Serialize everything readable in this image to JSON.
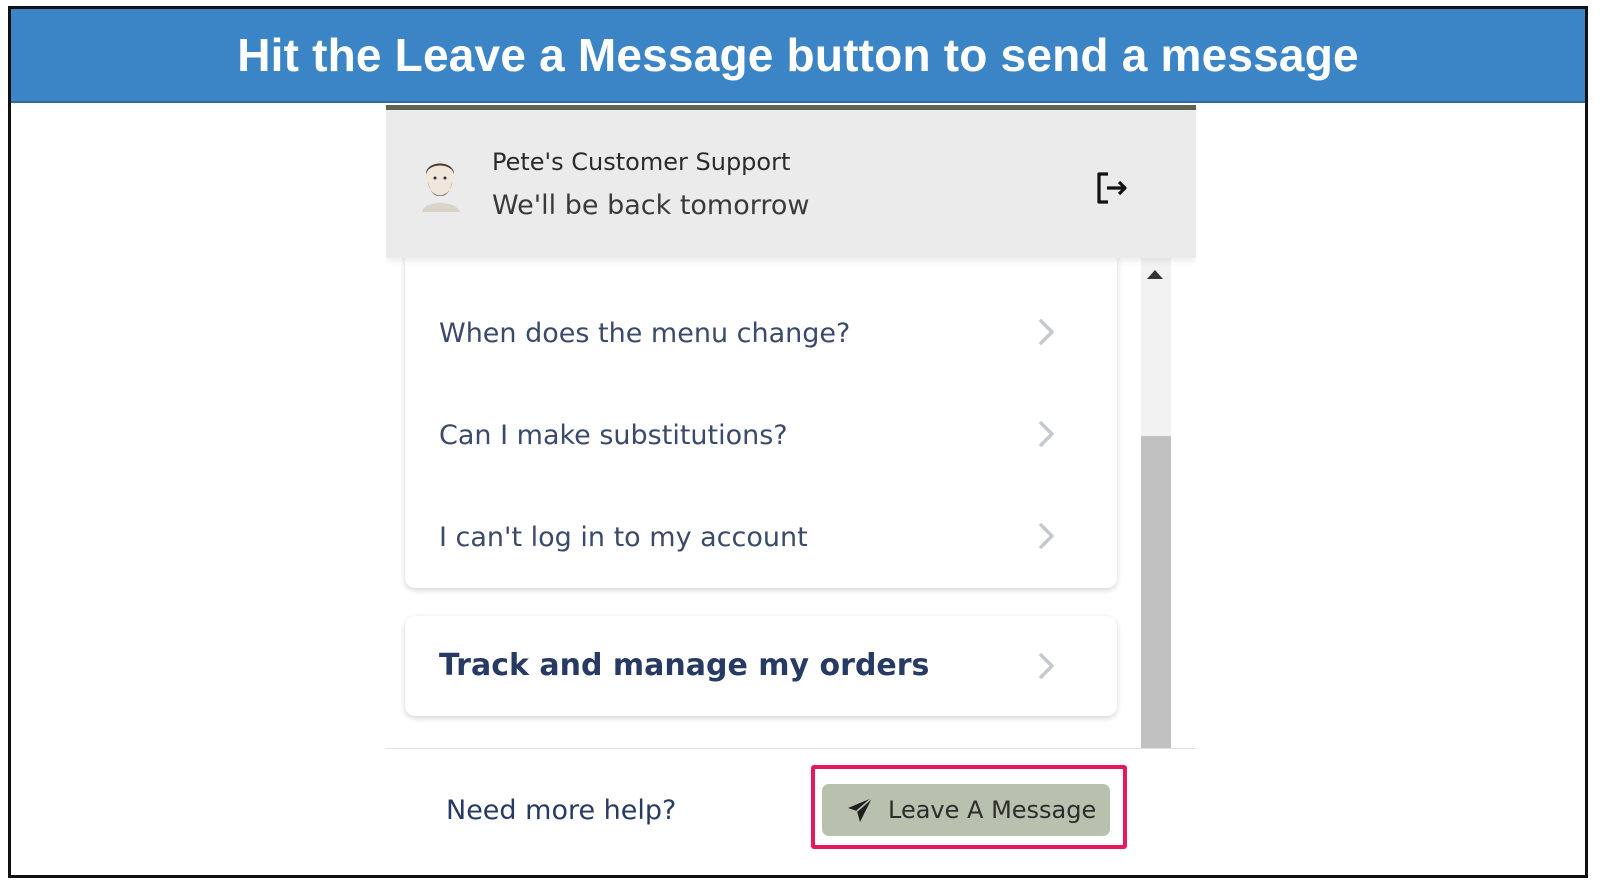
{
  "banner": {
    "title": "Hit the Leave a Message button to send a message"
  },
  "header": {
    "agent_name": "Pete's Customer Support",
    "status": "We'll be back tomorrow"
  },
  "faq": {
    "items": [
      {
        "label": "When does the menu change?"
      },
      {
        "label": "Can I make substitutions?"
      },
      {
        "label": "I can't log in to my account"
      }
    ]
  },
  "track": {
    "label": "Track and manage my orders"
  },
  "footer": {
    "help_text": "Need more help?",
    "leave_button_label": "Leave A Message"
  },
  "colors": {
    "banner": "#3b84c6",
    "header_bg": "#ebebeb",
    "button_bg": "#b8c0ae",
    "highlight_border": "#e8195a",
    "text_navy": "#263a63"
  },
  "icons": {
    "exit": "exit-icon",
    "chevron": "chevron-right-icon",
    "send": "paper-plane-icon",
    "avatar": "avatar"
  }
}
